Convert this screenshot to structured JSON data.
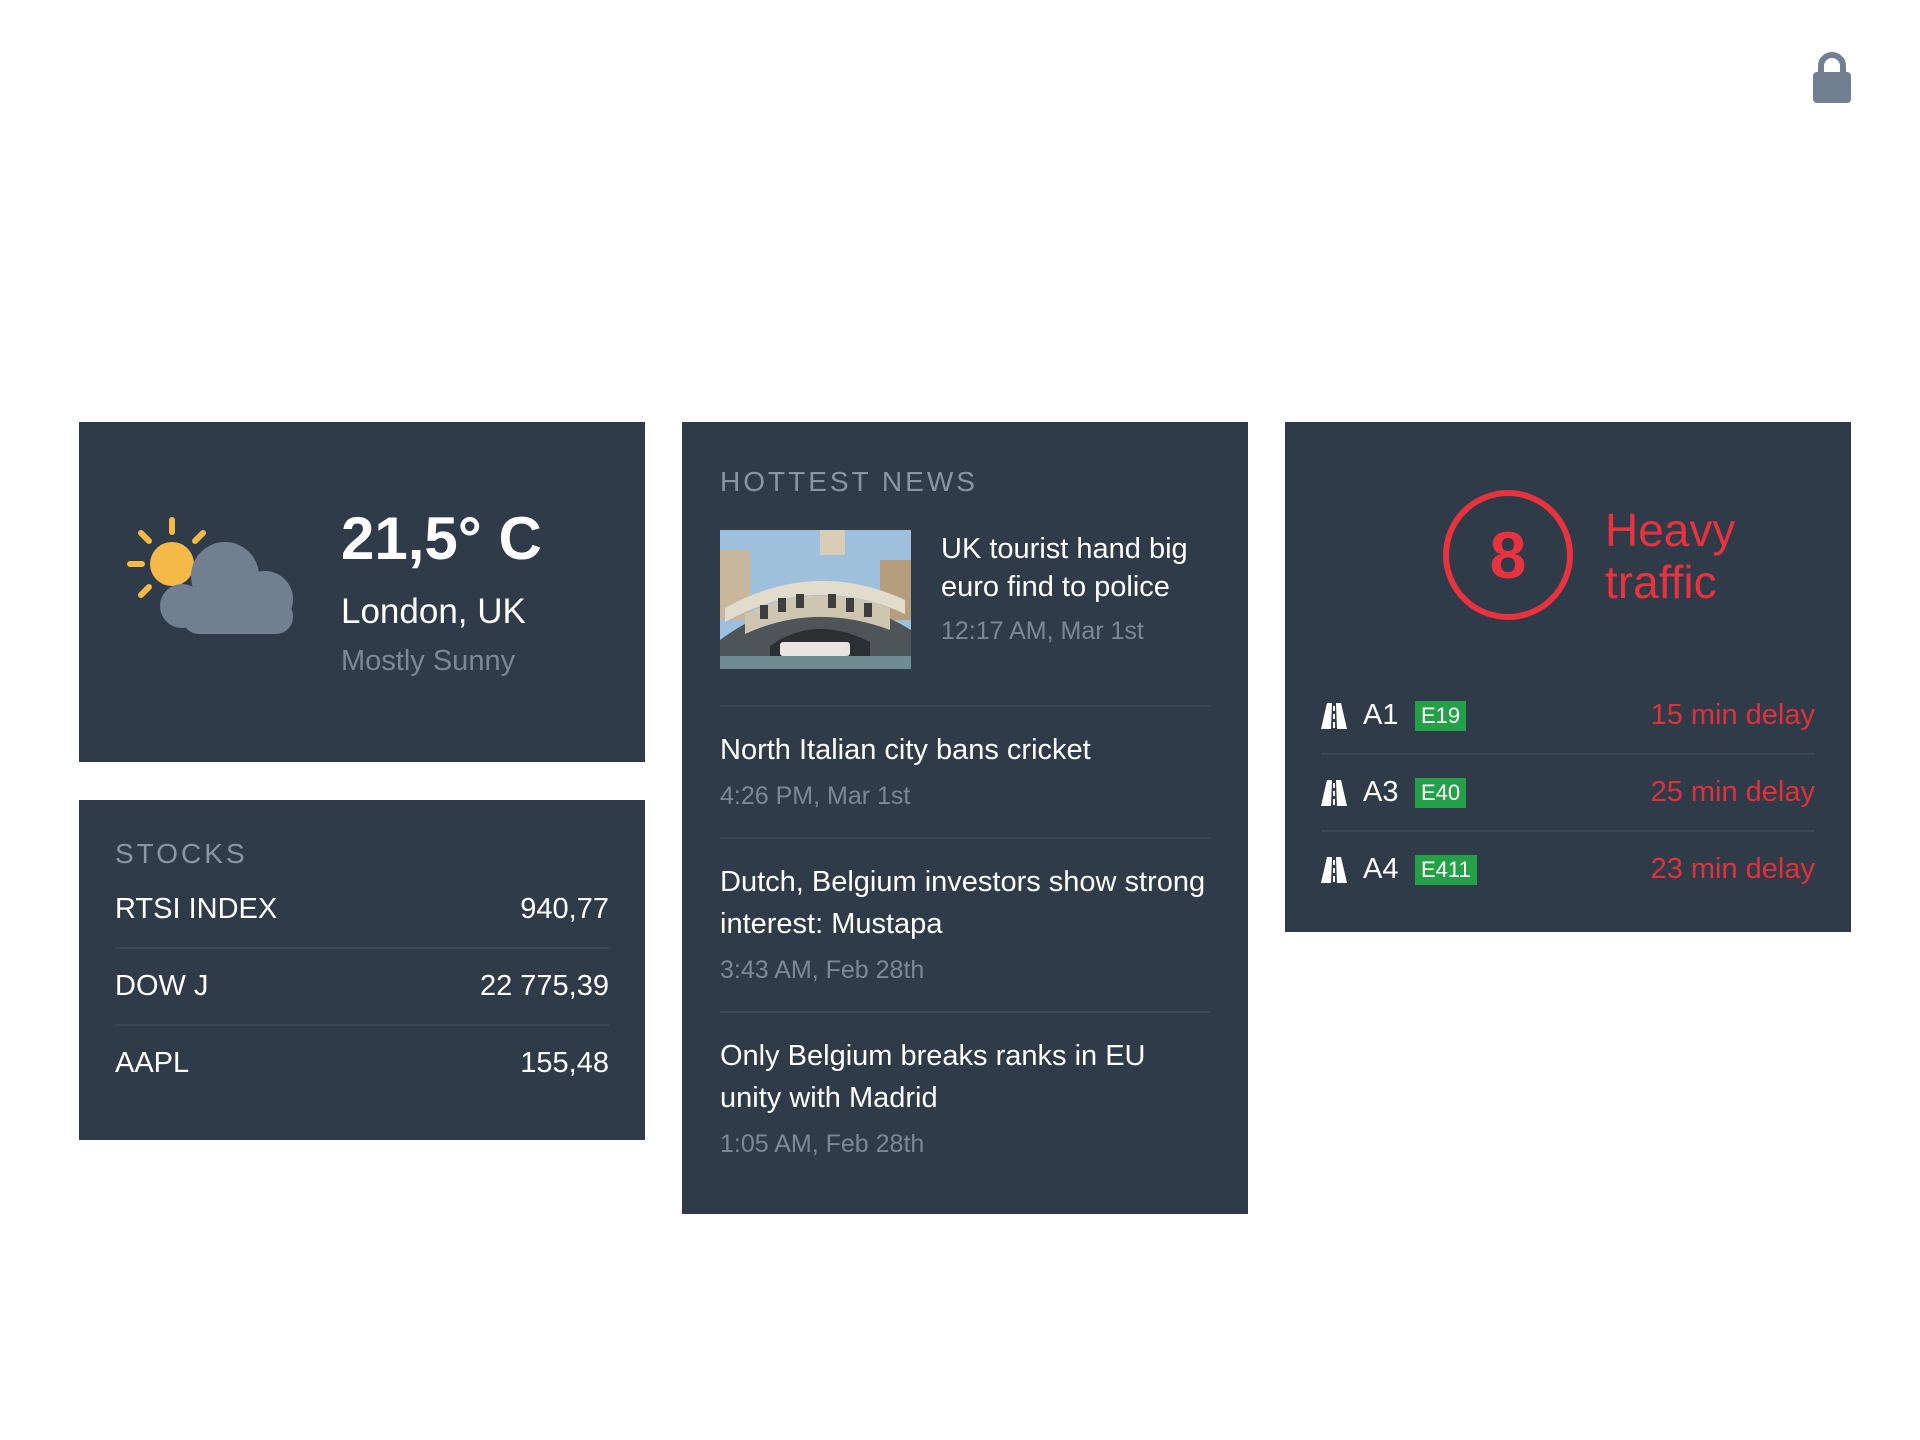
{
  "weather": {
    "temperature": "21,5° C",
    "city": "London, UK",
    "condition": "Mostly Sunny",
    "icon": "partly-sunny-icon"
  },
  "stocks": {
    "title": "STOCKS",
    "rows": [
      {
        "name": "RTSI INDEX",
        "value": "940,77"
      },
      {
        "name": "DOW J",
        "value": "22 775,39"
      },
      {
        "name": "AAPL",
        "value": "155,48"
      }
    ]
  },
  "news": {
    "title": "HOTTEST NEWS",
    "items": [
      {
        "headline": "UK tourist hand big euro find to police",
        "time": "12:17 AM, Mar 1st"
      },
      {
        "headline": "North Italian city bans cricket",
        "time": "4:26 PM, Mar 1st"
      },
      {
        "headline": "Dutch, Belgium investors show strong interest: Mustapa",
        "time": "3:43 AM, Feb 28th"
      },
      {
        "headline": "Only Belgium breaks ranks in EU unity with Madrid",
        "time": "1:05 AM, Feb 28th"
      }
    ]
  },
  "traffic": {
    "level": "8",
    "status": "Heavy traffic",
    "roads": [
      {
        "name": "A1",
        "badge": "E19",
        "delay": "15 min delay"
      },
      {
        "name": "A3",
        "badge": "E40",
        "delay": "25 min delay"
      },
      {
        "name": "A4",
        "badge": "E411",
        "delay": "23 min delay"
      }
    ]
  },
  "colors": {
    "card_bg": "#303b49",
    "alert_red": "#e8323d",
    "badge_green": "#24a148",
    "muted_text": "#7c8897"
  }
}
